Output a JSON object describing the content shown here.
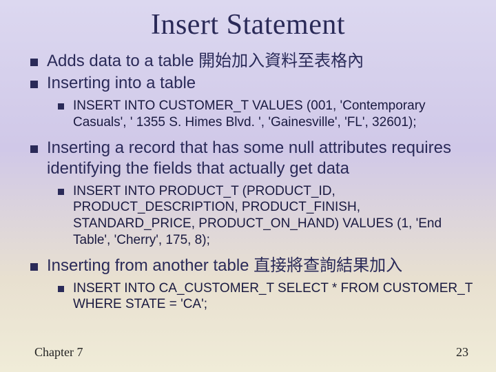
{
  "title": "Insert Statement",
  "bullets": {
    "b1": "Adds data to a table 開始加入資料至表格內",
    "b2": "Inserting into a table",
    "b2a": "INSERT INTO CUSTOMER_T VALUES (001, 'Contemporary Casuals', ' 1355 S. Himes Blvd. ', 'Gainesville', 'FL', 32601);",
    "b3": "Inserting a record that has some null attributes requires identifying the fields that actually get data",
    "b3a": "INSERT INTO PRODUCT_T (PRODUCT_ID, PRODUCT_DESCRIPTION, PRODUCT_FINISH, STANDARD_PRICE, PRODUCT_ON_HAND) VALUES (1, 'End Table', 'Cherry', 175, 8);",
    "b4": "Inserting from another table 直接將查詢結果加入",
    "b4a": "INSERT INTO CA_CUSTOMER_T SELECT * FROM CUSTOMER_T WHERE STATE = 'CA';"
  },
  "footer": {
    "left": "Chapter 7",
    "right": "23"
  }
}
